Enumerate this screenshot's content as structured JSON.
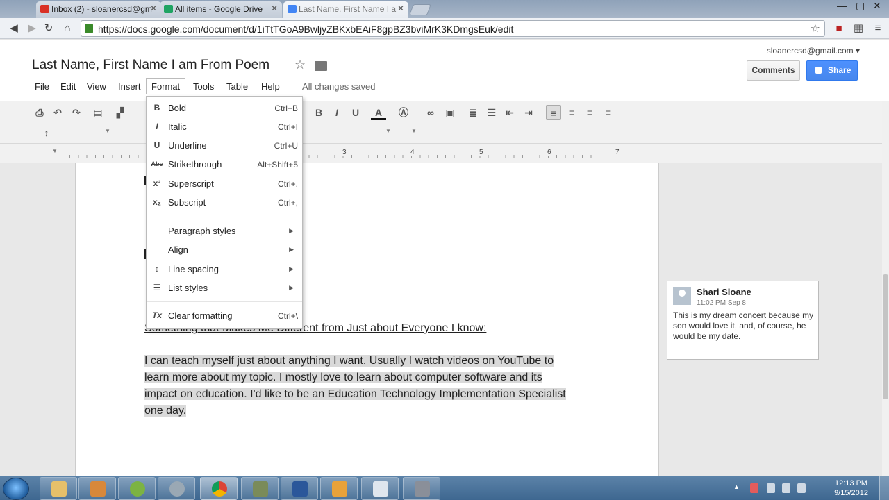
{
  "browser": {
    "tabs": [
      {
        "label": "Inbox (2) - sloanercsd@gm",
        "icon": "gmail-icon",
        "color": "#d93025"
      },
      {
        "label": "All items - Google Drive",
        "icon": "drive-icon",
        "color": "#1fa463"
      },
      {
        "label": "Last Name, First Name I a",
        "icon": "docs-icon",
        "color": "#4285f4"
      }
    ],
    "url": "https://docs.google.com/document/d/1iTtTGoA9BwljyZBKxbEAiF8gpBZ3bviMrK3KDmgsEuk/edit"
  },
  "docs": {
    "title": "Last Name, First Name I am From Poem",
    "account": "sloanercsd@gmail.com",
    "comments_label": "Comments",
    "share_label": "Share",
    "menus": [
      "File",
      "Edit",
      "View",
      "Insert",
      "Format",
      "Tools",
      "Table",
      "Help"
    ],
    "save_status": "All changes saved"
  },
  "ruler": {
    "numbers": [
      "3",
      "4",
      "5",
      "6",
      "7"
    ]
  },
  "format_menu": {
    "items": [
      {
        "icon": "B",
        "label": "Bold",
        "shortcut": "Ctrl+B"
      },
      {
        "icon": "I",
        "label": "Italic",
        "shortcut": "Ctrl+I"
      },
      {
        "icon": "U",
        "label": "Underline",
        "shortcut": "Ctrl+U"
      },
      {
        "icon": "Abc",
        "label": "Strikethrough",
        "shortcut": "Alt+Shift+5"
      },
      {
        "icon": "x²",
        "label": "Superscript",
        "shortcut": "Ctrl+."
      },
      {
        "icon": "x₂",
        "label": "Subscript",
        "shortcut": "Ctrl+,"
      },
      {
        "icon": "",
        "label": "Paragraph styles",
        "shortcut": ""
      },
      {
        "icon": "",
        "label": "Align",
        "shortcut": ""
      },
      {
        "icon": "↕",
        "label": "Line spacing",
        "shortcut": ""
      },
      {
        "icon": "☰",
        "label": "List styles",
        "shortcut": ""
      },
      {
        "icon": "Tx",
        "label": "Clear formatting",
        "shortcut": "Ctrl+\\"
      }
    ]
  },
  "document": {
    "heading": "Something that Makes Me Different from Just about Everyone I know:",
    "paragraph": [
      "I can teach myself just about anything I want. Usually I watch videos on YouTube to",
      "learn more about my topic. I mostly love to learn about computer software and its",
      "impact on education. I'd like to be an Education Technology Implementation Specialist",
      "one day."
    ]
  },
  "comment": {
    "author": "Shari Sloane",
    "timestamp": "11:02 PM Sep 8",
    "body": "This is my dream concert because my son would love it, and, of course, he would be my date."
  },
  "taskbar": {
    "time": "12:13 PM",
    "date": "9/15/2012"
  }
}
